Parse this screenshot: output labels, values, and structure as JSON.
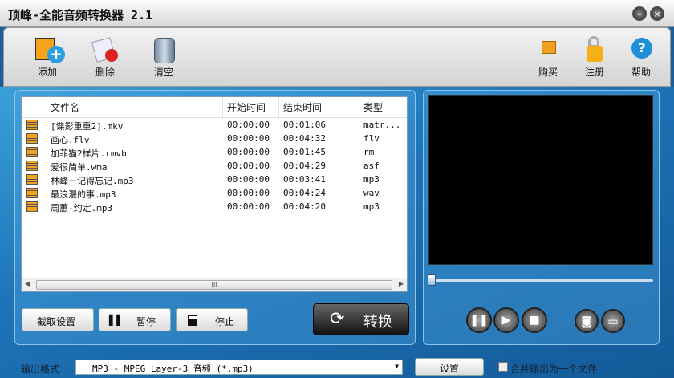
{
  "window": {
    "title": "顶峰-全能音频转换器 2.1",
    "minimize": "–",
    "close": "×"
  },
  "toolbar": {
    "add": "添加",
    "delete": "删除",
    "clear": "清空",
    "buy": "购买",
    "register": "注册",
    "help": "帮助"
  },
  "list": {
    "columns": [
      "文件名",
      "开始时间",
      "结束时间",
      "类型"
    ],
    "rows": [
      {
        "name": "[谍影重重2].mkv",
        "start": "00:00:00",
        "end": "00:01:06",
        "type": "matr..."
      },
      {
        "name": "画心.flv",
        "start": "00:00:00",
        "end": "00:04:32",
        "type": "flv"
      },
      {
        "name": "加菲猫2样片.rmvb",
        "start": "00:00:00",
        "end": "00:01:45",
        "type": "rm"
      },
      {
        "name": "爱很简单.wma",
        "start": "00:00:00",
        "end": "00:04:29",
        "type": "asf"
      },
      {
        "name": "林峰－记得忘记.mp3",
        "start": "00:00:00",
        "end": "00:03:41",
        "type": "mp3"
      },
      {
        "name": "最浪漫的事.mp3",
        "start": "00:00:00",
        "end": "00:04:24",
        "type": "wav"
      },
      {
        "name": "周蕙-约定.mp3",
        "start": "00:00:00",
        "end": "00:04:20",
        "type": "mp3"
      }
    ],
    "scroll_grip": "III"
  },
  "controls": {
    "trim_settings": "截取设置",
    "pause": "暂停",
    "stop": "停止",
    "convert": "转换"
  },
  "player": {
    "progress": 0
  },
  "output": {
    "label": "输出格式:",
    "format": "MP3 - MPEG Layer-3 音频 (*.mp3)",
    "settings": "设置",
    "merge_label": "合并输出为一个文件",
    "merge_checked": false
  }
}
